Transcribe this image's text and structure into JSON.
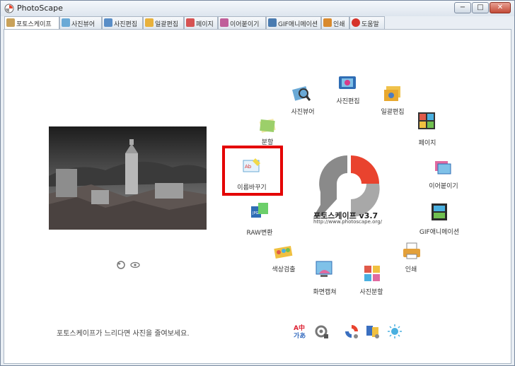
{
  "window": {
    "title": "PhotoScape",
    "buttons": {
      "minimize": "−",
      "maximize": "□",
      "close": "✕"
    }
  },
  "tabs": [
    {
      "label": "포토스케이프",
      "icon": "photoscape-icon",
      "active": true
    },
    {
      "label": "사진뷰어",
      "icon": "viewer-icon"
    },
    {
      "label": "사진편집",
      "icon": "editor-icon"
    },
    {
      "label": "일괄편집",
      "icon": "batch-icon"
    },
    {
      "label": "페이지",
      "icon": "page-icon"
    },
    {
      "label": "이어붙이기",
      "icon": "combine-icon"
    },
    {
      "label": "GIF애니메이션",
      "icon": "gif-icon"
    },
    {
      "label": "인쇄",
      "icon": "print-icon"
    },
    {
      "label": "도움말",
      "icon": "help-icon"
    }
  ],
  "menu": [
    {
      "id": "viewer",
      "label": "사진뷰어"
    },
    {
      "id": "editor",
      "label": "사진편집"
    },
    {
      "id": "batch",
      "label": "일괄편집"
    },
    {
      "id": "page",
      "label": "페이지"
    },
    {
      "id": "splitter",
      "label": "분할"
    },
    {
      "id": "rename",
      "label": "이름바꾸기"
    },
    {
      "id": "combine",
      "label": "이어붙이기"
    },
    {
      "id": "gif",
      "label": "GIF애니메이션"
    },
    {
      "id": "raw",
      "label": "RAW변환"
    },
    {
      "id": "print",
      "label": "인쇄"
    },
    {
      "id": "colorpicker",
      "label": "색상검출"
    },
    {
      "id": "capture",
      "label": "화면캡쳐"
    },
    {
      "id": "split",
      "label": "사진분할"
    }
  ],
  "brand": {
    "name": "포토스케이프 v3.7",
    "url": "http://www.photoscape.org/"
  },
  "hint": "포토스케이프가 느리다면 사진을 줄여보세요.",
  "tools": [
    {
      "name": "language-icon",
      "glyph_top": "A中",
      "glyph_bottom": "가あ"
    },
    {
      "name": "settings-icon"
    },
    {
      "name": "photoscape-update-icon"
    },
    {
      "name": "skin-icon"
    },
    {
      "name": "brightness-icon"
    }
  ],
  "colors": {
    "accent": "#e9432e",
    "logo_gray": "#8a8a8a",
    "highlight": "#e40000"
  }
}
